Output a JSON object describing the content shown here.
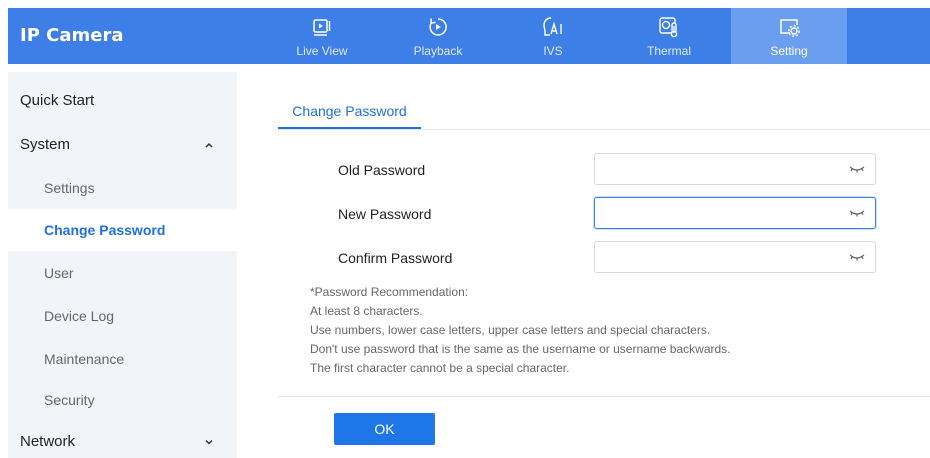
{
  "header": {
    "brand": "IP Camera",
    "nav": [
      {
        "label": "Live View",
        "icon": "live-view-icon"
      },
      {
        "label": "Playback",
        "icon": "playback-icon"
      },
      {
        "label": "IVS",
        "icon": "ivs-icon"
      },
      {
        "label": "Thermal",
        "icon": "thermal-icon"
      },
      {
        "label": "Setting",
        "icon": "setting-icon",
        "active": true
      }
    ]
  },
  "sidebar": {
    "items": [
      {
        "label": "Quick Start",
        "level": "top"
      },
      {
        "label": "System",
        "level": "top",
        "expanded": true
      },
      {
        "label": "Settings",
        "level": "sub"
      },
      {
        "label": "Change Password",
        "level": "sub",
        "active": true
      },
      {
        "label": "User",
        "level": "sub"
      },
      {
        "label": "Device Log",
        "level": "sub"
      },
      {
        "label": "Maintenance",
        "level": "sub"
      },
      {
        "label": "Security",
        "level": "sub"
      },
      {
        "label": "Network",
        "level": "top",
        "expanded": false
      }
    ]
  },
  "main": {
    "tab": "Change Password",
    "fields": {
      "old_password": {
        "label": "Old Password",
        "value": ""
      },
      "new_password": {
        "label": "New Password",
        "value": ""
      },
      "confirm_password": {
        "label": "Confirm Password",
        "value": ""
      }
    },
    "recommendation": [
      "*Password Recommendation:",
      "At least 8 characters.",
      "Use numbers, lower case letters, upper case letters and special characters.",
      "Don't use password that is the same as the username or username backwards.",
      "The first character cannot be a special character."
    ],
    "ok_label": "OK"
  },
  "colors": {
    "header_bg": "#3d7fe6",
    "header_active": "#6a9eee",
    "accent": "#1f6fe0",
    "sidebar_bg": "#f1f4f9"
  }
}
